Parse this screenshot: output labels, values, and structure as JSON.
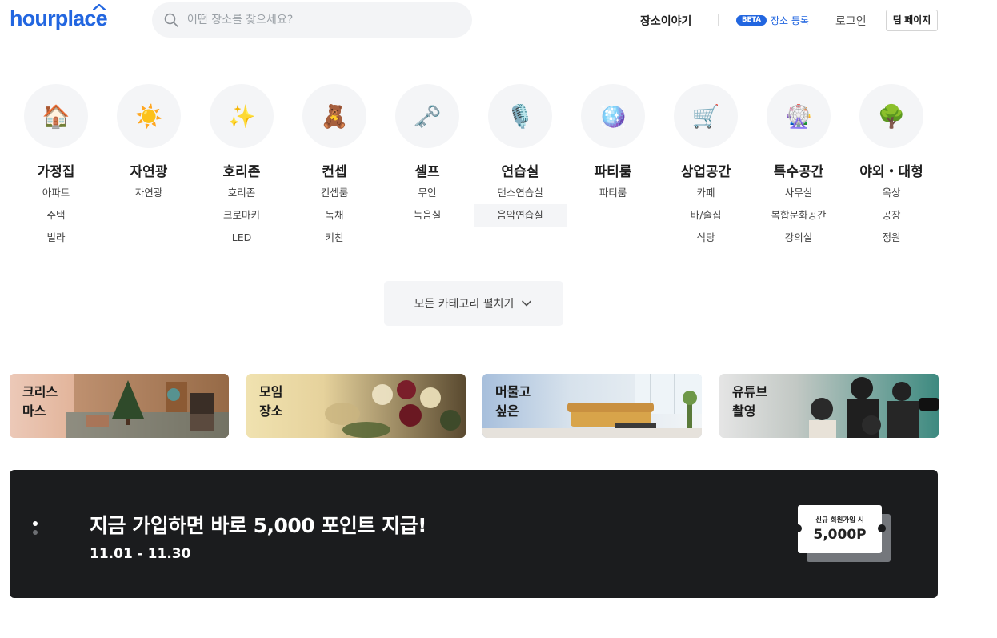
{
  "header": {
    "logo": "hourplace",
    "search_placeholder": "어떤 장소를 찾으세요?",
    "nav": {
      "story": "장소이야기",
      "beta_badge": "BETA",
      "register": "장소 등록",
      "login": "로그인",
      "team_page": "팀 페이지"
    }
  },
  "categories": [
    {
      "icon": "house-icon",
      "emoji": "🏠",
      "name": "가정집",
      "subs": [
        "아파트",
        "주택",
        "빌라"
      ]
    },
    {
      "icon": "sun-icon",
      "emoji": "☀️",
      "name": "자연광",
      "subs": [
        "자연광"
      ]
    },
    {
      "icon": "sparkles-icon",
      "emoji": "✨",
      "name": "호리존",
      "subs": [
        "호리존",
        "크로마키",
        "LED"
      ]
    },
    {
      "icon": "teddy-bear-icon",
      "emoji": "🧸",
      "name": "컨셉",
      "subs": [
        "컨셉룸",
        "독채",
        "키친"
      ]
    },
    {
      "icon": "key-icon",
      "emoji": "🗝️",
      "name": "셀프",
      "subs": [
        "무인",
        "녹음실"
      ]
    },
    {
      "icon": "microphone-icon",
      "emoji": "🎙️",
      "name": "연습실",
      "subs": [
        "댄스연습실",
        "음악연습실"
      ]
    },
    {
      "icon": "disco-ball-icon",
      "emoji": "🪩",
      "name": "파티룸",
      "subs": [
        "파티룸"
      ]
    },
    {
      "icon": "shopping-cart-icon",
      "emoji": "🛒",
      "name": "상업공간",
      "subs": [
        "카페",
        "바/술집",
        "식당"
      ]
    },
    {
      "icon": "ferris-wheel-icon",
      "emoji": "🎡",
      "name": "특수공간",
      "subs": [
        "사무실",
        "복합문화공간",
        "강의실"
      ]
    },
    {
      "icon": "tree-icon",
      "emoji": "🌳",
      "name": "야외・대형",
      "subs": [
        "옥상",
        "공장",
        "정원"
      ]
    }
  ],
  "expand_button": "모든 카테고리 펼치기",
  "themes": [
    {
      "title": "크리스\n마스",
      "color": "#e9c7b6"
    },
    {
      "title": "모임\n장소",
      "color": "#efe1b0"
    },
    {
      "title": "머물고\n싶은",
      "color": "#a9c1de"
    },
    {
      "title": "유튜브\n촬영",
      "color": "#e3e3e3"
    }
  ],
  "banner": {
    "title": "지금 가입하면 바로 5,000 포인트 지급!",
    "date": "11.01 - 11.30",
    "coupon_label": "신규 회원가입 시",
    "coupon_value": "5,000P",
    "background": "#1b1c1e"
  },
  "colors": {
    "brand": "#2266e0",
    "bubble": "#f4f5f7"
  }
}
